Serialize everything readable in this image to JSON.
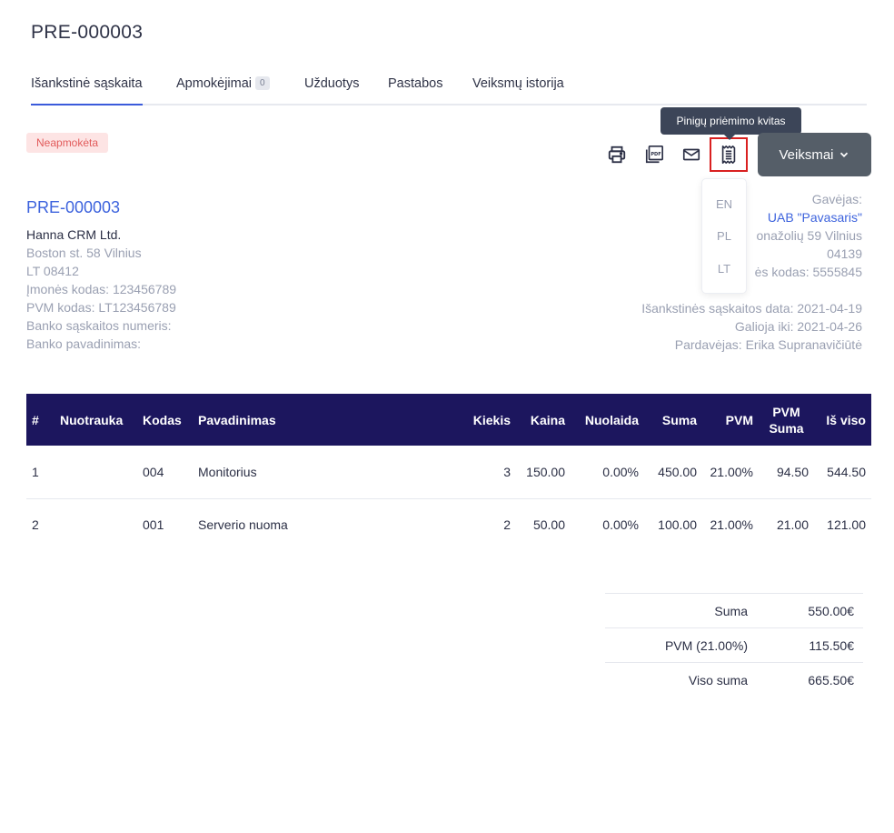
{
  "page": {
    "title": "PRE-000003"
  },
  "tabs": [
    {
      "label": "Išankstinė sąskaita",
      "active": true
    },
    {
      "label": "Apmokėjimai",
      "badge": "0"
    },
    {
      "label": "Užduotys"
    },
    {
      "label": "Pastabos"
    },
    {
      "label": "Veiksmų istorija"
    }
  ],
  "status": {
    "label": "Neapmokėta",
    "color": "#e25b5b"
  },
  "toolbar": {
    "tooltip": "Pinigų priėmimo kvitas",
    "actions_label": "Veiksmai",
    "icons": [
      "printer-icon",
      "pdf-icon",
      "mail-icon",
      "receipt-icon",
      "chevron-down-icon"
    ]
  },
  "language_menu": [
    "EN",
    "PL",
    "LT"
  ],
  "seller": {
    "document_id": "PRE-000003",
    "name": "Hanna CRM Ltd.",
    "address": "Boston st. 58 Vilnius",
    "postcode": "LT 08412",
    "company_code": "Įmonės kodas: 123456789",
    "vat_code": "PVM kodas: LT123456789",
    "bank_account": "Banko sąskaitos numeris:",
    "bank_name": "Banko pavadinimas:"
  },
  "client": {
    "heading": "Gavėjas:",
    "name": "UAB \"Pavasaris\"",
    "address": "onažolių 59 Vilnius",
    "postcode": "04139",
    "company_code": "ės kodas: 5555845",
    "invoice_date": "Išankstinės sąskaitos data: 2021-04-19",
    "valid_until": "Galioja iki: 2021-04-26",
    "seller_person": "Pardavėjas: Erika Supranavičiūtė"
  },
  "table": {
    "headers": {
      "num": "#",
      "image": "Nuotrauka",
      "code": "Kodas",
      "name": "Pavadinimas",
      "qty": "Kiekis",
      "price": "Kaina",
      "discount": "Nuolaida",
      "sum": "Suma",
      "vat": "PVM",
      "vat_sum_1": "PVM",
      "vat_sum_2": "Suma",
      "total": "Iš viso"
    },
    "rows": [
      {
        "num": "1",
        "code": "004",
        "name": "Monitorius",
        "qty": "3",
        "price": "150.00",
        "discount": "0.00%",
        "sum": "450.00",
        "vat": "21.00%",
        "vat_sum": "94.50",
        "total": "544.50"
      },
      {
        "num": "2",
        "code": "001",
        "name": "Serverio nuoma",
        "qty": "2",
        "price": "50.00",
        "discount": "0.00%",
        "sum": "100.00",
        "vat": "21.00%",
        "vat_sum": "21.00",
        "total": "121.00"
      }
    ],
    "header_bg": "#1c165e"
  },
  "totals": {
    "sum_label": "Suma",
    "sum_value": "550.00€",
    "vat_label": "PVM (21.00%)",
    "vat_value": "115.50€",
    "grand_label": "Viso suma",
    "grand_value": "665.50€"
  },
  "colors": {
    "accent": "#3d63dd",
    "actions_button": "#555e68",
    "highlight_border": "#d92020"
  }
}
